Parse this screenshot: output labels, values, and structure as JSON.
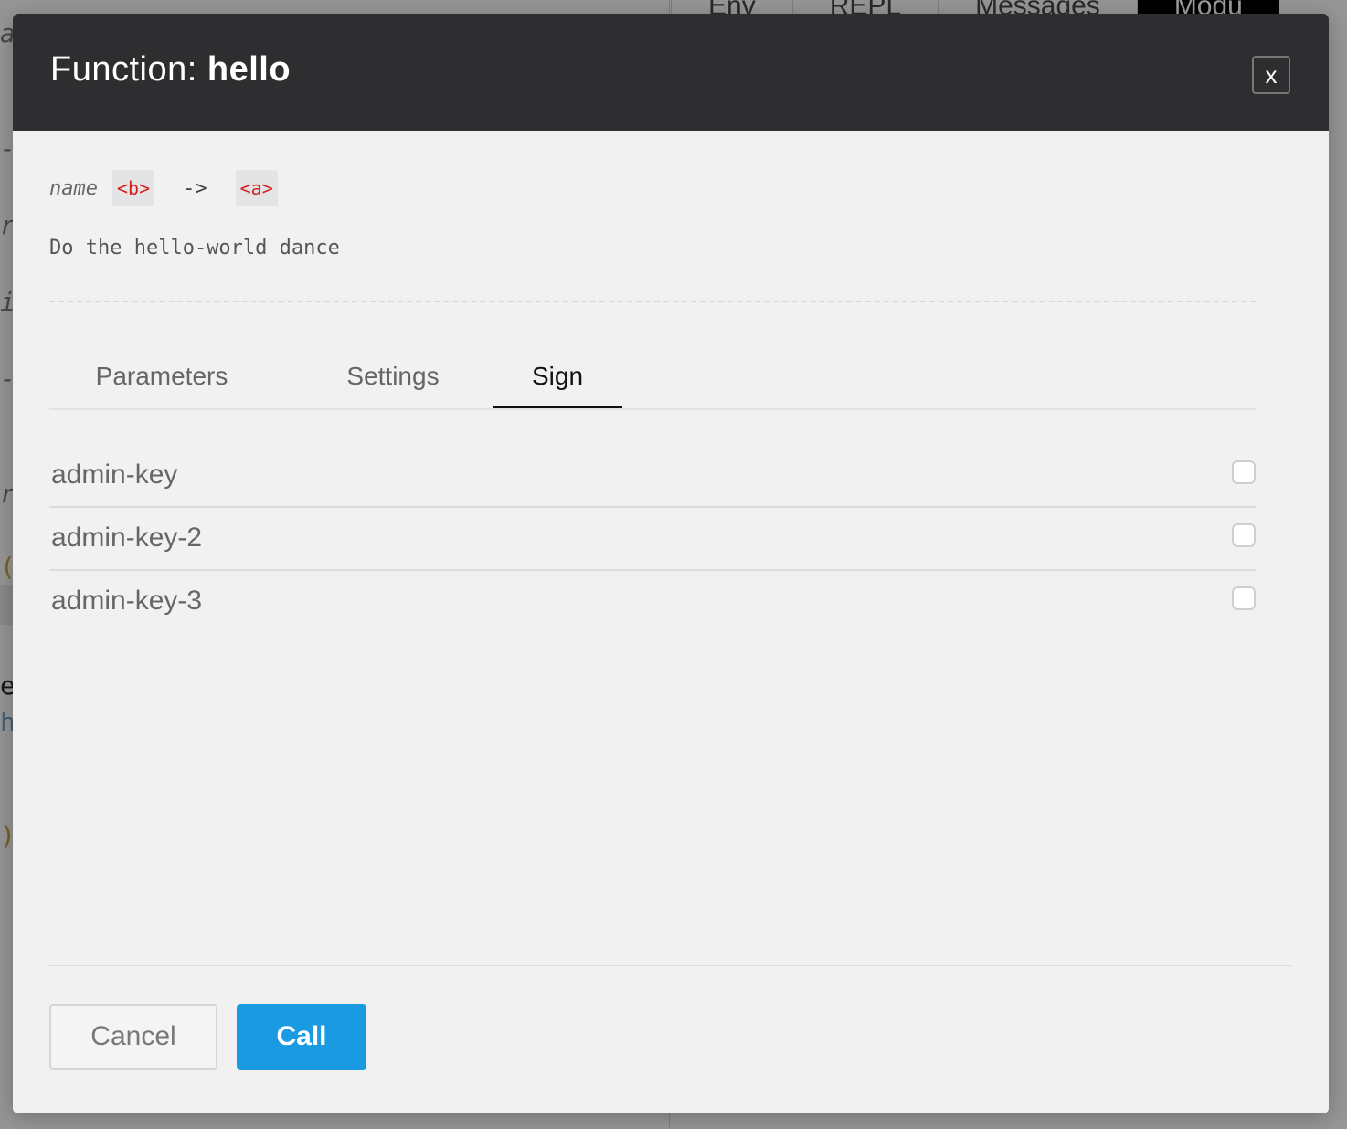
{
  "background": {
    "tabs": [
      "Env",
      "REPL",
      "Messages",
      "Modu"
    ],
    "glyphs": [
      "a",
      "-",
      "r",
      "i",
      "-",
      "r",
      "(",
      "e",
      "h",
      ")"
    ]
  },
  "modal": {
    "title_prefix": "Function: ",
    "function_name": "hello",
    "close_label": "x",
    "signature": {
      "param_name": "name",
      "param_type": "<b>",
      "arrow": "->",
      "return_type": "<a>"
    },
    "doc": "Do the hello-world dance",
    "tabs": [
      {
        "label": "Parameters",
        "active": false
      },
      {
        "label": "Settings",
        "active": false
      },
      {
        "label": "Sign",
        "active": true
      }
    ],
    "sign_keys": [
      {
        "label": "admin-key",
        "checked": false
      },
      {
        "label": "admin-key-2",
        "checked": false
      },
      {
        "label": "admin-key-3",
        "checked": false
      }
    ],
    "footer": {
      "cancel_label": "Cancel",
      "call_label": "Call"
    }
  },
  "colors": {
    "header_bg": "#2e2e30",
    "accent": "#1a9ae0",
    "type_tag_text": "#d42020"
  }
}
